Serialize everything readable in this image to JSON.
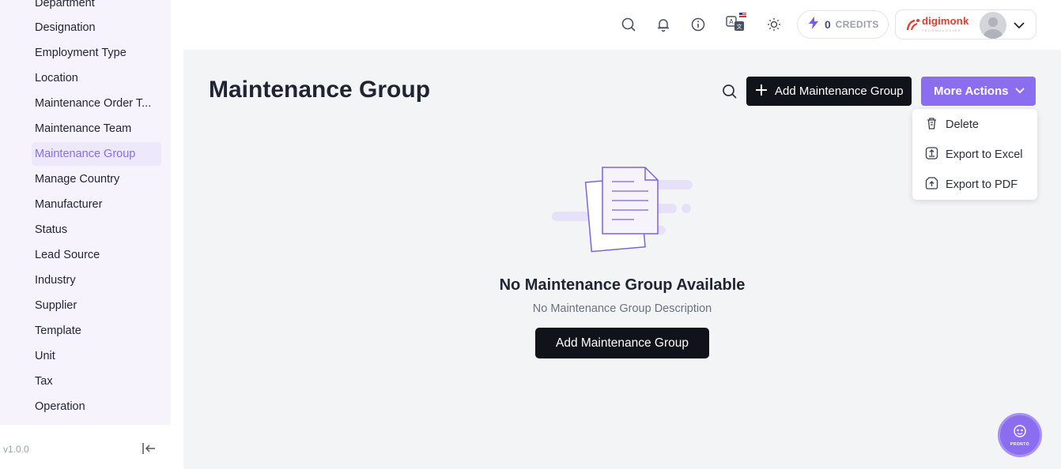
{
  "sidebar": {
    "items": [
      {
        "label": "Department"
      },
      {
        "label": "Designation"
      },
      {
        "label": "Employment Type"
      },
      {
        "label": "Location"
      },
      {
        "label": "Maintenance Order T..."
      },
      {
        "label": "Maintenance Team"
      },
      {
        "label": "Maintenance Group"
      },
      {
        "label": "Manage Country"
      },
      {
        "label": "Manufacturer"
      },
      {
        "label": "Status"
      },
      {
        "label": "Lead Source"
      },
      {
        "label": "Industry"
      },
      {
        "label": "Supplier"
      },
      {
        "label": "Template"
      },
      {
        "label": "Unit"
      },
      {
        "label": "Tax"
      },
      {
        "label": "Operation"
      }
    ],
    "active_index": 6,
    "version": "v1.0.0"
  },
  "topbar": {
    "icons": [
      "search-icon",
      "bell-icon",
      "info-icon",
      "translate-icon",
      "sun-icon"
    ],
    "credits": {
      "count": "0",
      "label": "CREDITS"
    },
    "brand": {
      "name": "digimonk",
      "tagline": "TECHNOLOGIES"
    }
  },
  "page": {
    "title": "Maintenance Group",
    "add_button": "Add Maintenance Group",
    "more_actions": "More Actions",
    "dropdown": [
      {
        "label": "Delete",
        "icon": "trash-icon"
      },
      {
        "label": "Export to Excel",
        "icon": "export-excel-icon"
      },
      {
        "label": "Export to PDF",
        "icon": "export-pdf-icon"
      }
    ],
    "empty": {
      "title": "No Maintenance Group Available",
      "description": "No Maintenance Group Description",
      "button": "Add Maintenance Group"
    },
    "fab_label": "PRONTO"
  },
  "colors": {
    "accent": "#8b6ef0",
    "dark_button": "#11131b",
    "sidebar_bg": "#f6f3fd",
    "brand_red": "#e63b2e"
  }
}
